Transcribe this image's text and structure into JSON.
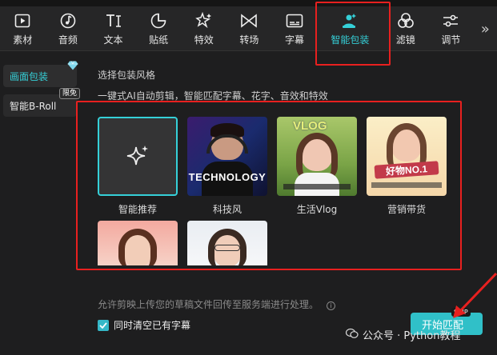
{
  "topbar": {
    "title": ""
  },
  "toolbar": {
    "items": [
      {
        "label": "素材",
        "icon": "media-icon"
      },
      {
        "label": "音频",
        "icon": "audio-icon"
      },
      {
        "label": "文本",
        "icon": "text-icon"
      },
      {
        "label": "贴纸",
        "icon": "sticker-icon"
      },
      {
        "label": "特效",
        "icon": "effects-icon"
      },
      {
        "label": "转场",
        "icon": "transition-icon"
      },
      {
        "label": "字幕",
        "icon": "subtitle-icon"
      },
      {
        "label": "智能包装",
        "icon": "smart-pack-icon"
      },
      {
        "label": "滤镜",
        "icon": "filter-icon"
      },
      {
        "label": "调节",
        "icon": "adjust-icon"
      }
    ],
    "more": "»"
  },
  "sidebar": {
    "items": [
      {
        "label": "画面包装",
        "badge": ""
      },
      {
        "label": "智能B-Roll",
        "badge": "限免"
      }
    ]
  },
  "main": {
    "heading": "选择包装风格",
    "subheading": "一键式AI自动剪辑，智能匹配字幕、花字、音效和特效",
    "styles": [
      {
        "label": "智能推荐"
      },
      {
        "label": "科技风",
        "thumb_text": "TECHNOLOGY"
      },
      {
        "label": "生活Vlog",
        "thumb_text": "VLOG"
      },
      {
        "label": "营销带货",
        "thumb_text": "好物NO.1"
      },
      {
        "label": ""
      },
      {
        "label": ""
      }
    ],
    "notice": "允许剪映上传您的草稿文件回传至服务端进行处理。",
    "checkbox_label": "同时清空已有字幕",
    "start_button": "开始匹配",
    "vip_tag": "SVIP"
  },
  "watermark": "公众号 · Python教程",
  "colors": {
    "accent": "#35d0d8",
    "highlight": "#e8201f",
    "panel": "#1e1e1f"
  }
}
